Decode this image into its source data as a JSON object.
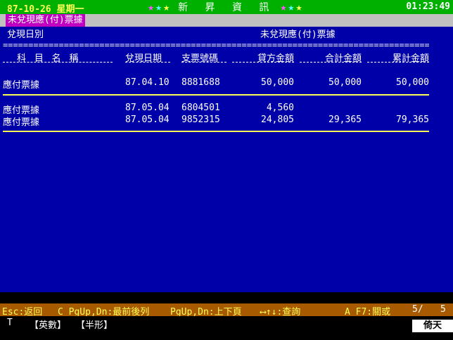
{
  "header": {
    "date": "87-10-26 星期一",
    "brand_stars_left": [
      "★",
      "★",
      "★"
    ],
    "brand": "新 昇 資 訊",
    "brand_stars_right": [
      "★",
      "★",
      "★"
    ],
    "clock": "01:23:49",
    "star_colors": [
      "#ff55ff",
      "#55ffff",
      "#ffff55"
    ]
  },
  "window_title": "未兌現應(付)票據",
  "report": {
    "left_label": "兌現日別",
    "right_title": "未兌現應(付)票據",
    "equals_line": "================================================================================================",
    "columns": [
      "科 目 名 稱",
      "兌現日期",
      "支票號碼",
      "貸方金額",
      "合計金額",
      "累計金額"
    ],
    "rows_group1": [
      {
        "account": "應付票據",
        "date": "87.04.10",
        "check": "8881688",
        "credit": "50,000",
        "total": "50,000",
        "cumulative": "50,000"
      }
    ],
    "rows_group2": [
      {
        "account": "應付票據",
        "date": "87.05.04",
        "check": "6804501",
        "credit": "4,560",
        "total": "",
        "cumulative": ""
      },
      {
        "account": "應付票據",
        "date": "87.05.04",
        "check": "9852315",
        "credit": "24,805",
        "total": "29,365",
        "cumulative": "79,365"
      }
    ]
  },
  "keys": {
    "esc": "Esc:返回",
    "cpg": "C_PgUp,Dn:最前後列",
    "pg": "PgUp,Dn:上下頁",
    "arrows": "⟷↑↓:查詢",
    "af7": "A_F7:關或",
    "page_current": "5/",
    "page_total": "5"
  },
  "status": {
    "mode": "T",
    "lang": "【英數】",
    "width": "【半形】",
    "ime": "倚天"
  }
}
